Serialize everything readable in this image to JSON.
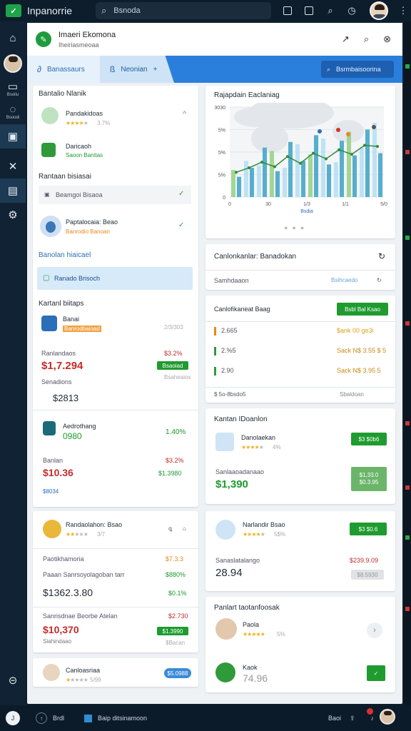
{
  "topbar": {
    "app_title": "Inpanorrie",
    "search_text": "Bsnoda"
  },
  "rail": {
    "label_2": "Bsoilu",
    "label_3": "Bsoodi"
  },
  "window": {
    "title": "Imaeri Ekomona",
    "subtitle": "Iheiriasmeoaa"
  },
  "tabs": {
    "tab1": "Banassaurs",
    "tab2": "Neonian",
    "tab2_plus": "+",
    "action_button": "Bsrmbaisoorina"
  },
  "left_col": {
    "section1_title": "Bantalio Nlanik",
    "item1_name": "Pandakidoas",
    "item1_rating": "3.7%",
    "item2_name": "Daricaoh",
    "item2_sub": "Saoon Banitas",
    "section2_title": "Rantaan bisiasai",
    "dropdown1": "Beamgoi Bisaoa",
    "item3_name": "Paptalocaia: Beao",
    "item3_sub": "Banrodio Banoan",
    "section3_title": "Banolan hiaicael",
    "selected_item": "Ranado Brisoch",
    "section4_title": "Kartanl biitaps",
    "c1_name": "Banai",
    "c1_badge": "Banrodbaioad",
    "c1_time": "2/3/303",
    "c1_label": "Ranlandaos",
    "c1_big": "$1,7.294",
    "c1_val_red": "$3.2%",
    "c1_btn": "Bsaoiad",
    "c1_small": "Bsaheaios",
    "c1_label2": "Senadions",
    "c1_val2": "$2813",
    "c2_name": "Aedrothang",
    "c2_num": "0980",
    "c2_pct": "1.40%",
    "c2_label": "Banlan",
    "c2_big": "$10.36",
    "c2_red": "$3.2%",
    "c2_green": "$1.3980",
    "c2_small": "$8034",
    "c3_name": "Randaolahon: Bsao",
    "c3_rating": "3/7",
    "c3_row1_label": "Paotikhamoria",
    "c3_row1_val": "$7.3.3",
    "c3_row2_label": "Paaan Sanrsoyolagoban tarr",
    "c3_row2_val": "$880%",
    "c3_big": "$1362.3.80",
    "c3_big_pct": "$0.1%",
    "c3_label3": "Sanrisdnae Beorbe Atelan",
    "c3_red": "$2.730",
    "c3_big2": "$10,370",
    "c3_btn": "$1.3990",
    "c3_small": "Siahindaao",
    "c3_small2": "$Bacan",
    "c4_name": "Canloasriaa",
    "c4_rating": "5/99",
    "c4_btn": "$5.0988"
  },
  "right_col": {
    "chart_title": "Rajapdain Eaclaniag",
    "chart_xlabel": "Bsdia",
    "panel2_title": "Canlonkanlar: Banadokan",
    "panel2_row": "Samhdaaon",
    "panel2_right": "Bsihcaedo",
    "panel3_title": "Canlofikaneat Baag",
    "panel3_btn": "Bsbl Bal Ksao",
    "list": [
      {
        "left": "2.665",
        "right": "$ank 00 ge3i"
      },
      {
        "left": "2.%5",
        "right": "Sack N$ 3.55 $ 5"
      },
      {
        "left": "2.90",
        "right": "Sack N$ 3.95 5"
      }
    ],
    "panel3_footer_left": "$ 5o-8bsdo5",
    "panel3_footer_right": "Sbaldoan",
    "panel4_title": "Kantan IDoanlon",
    "p4_name": "Danolaekan",
    "p4_rating": "4%",
    "p4_btn": "$3 $0b6",
    "p4_label": "Sanlaaoadanaao",
    "p4_big": "$1,390",
    "p4_btn2": "$1,33.0 $0.3.95",
    "p5_name": "Narlandir Bsao",
    "p5_rating": "5$%",
    "p5_btn": "$3 $0.6",
    "p5_label": "Sanaslatalango",
    "p5_red": "$239.9.09",
    "p5_big": "28.94",
    "p5_small": "$8.5930",
    "panel6_title": "Panlart taotanfoosak",
    "p6_name": "Paola",
    "p6_rating": "5%",
    "p6_name2": "Kaok",
    "p6_big": "74.96"
  },
  "taskbar": {
    "start_label": "J",
    "item1": "Brdl",
    "item2": "Baip ditsinamoon",
    "item3": "Baoi"
  },
  "chart_data": {
    "type": "bar",
    "title": "Rajapdain Eaclaniag",
    "xlabel": "Bsdia",
    "ylabel": "",
    "y_tick_labels": [
      "3030",
      "5%",
      "5%",
      "5%",
      "0"
    ],
    "x_tick_labels": [
      "0",
      "30",
      "1/3",
      "1/1",
      "5/0"
    ],
    "series": [
      {
        "values": [
          2.4,
          3.2,
          2.8,
          4.1,
          2.6,
          4.7,
          3.8,
          5.2,
          3.1,
          5.8,
          4.4,
          6.6
        ]
      },
      {
        "values": [
          1.8,
          2.6,
          4.4,
          2.3,
          4.9,
          3.2,
          5.5,
          2.9,
          5.0,
          3.7,
          6.0,
          3.9
        ]
      }
    ],
    "line": [
      2.2,
      2.6,
      3.1,
      2.7,
      3.6,
      3.0,
      3.9,
      3.4,
      4.2,
      3.8,
      4.6,
      4.5
    ],
    "ylim": [
      0,
      8
    ],
    "colors": [
      "#b9dff3",
      "#45a6c9",
      "#9bd18a",
      "#2f8b3a"
    ],
    "grid": true,
    "legend": "none"
  }
}
